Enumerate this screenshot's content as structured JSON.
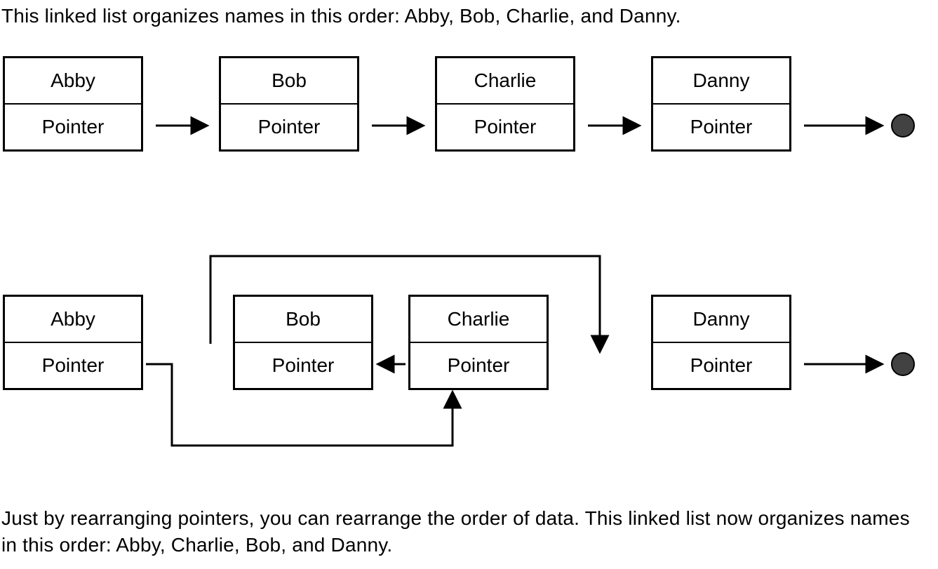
{
  "caption_top": "This linked list organizes names in this order: Abby, Bob, Charlie, and Danny.",
  "caption_bottom": "Just by rearranging pointers, you can rearrange the order of data. This linked list now organizes names in this order: Abby, Charlie, Bob, and Danny.",
  "pointer_label": "Pointer",
  "list1": {
    "nodes": [
      "Abby",
      "Bob",
      "Charlie",
      "Danny"
    ]
  },
  "list2": {
    "nodes": [
      "Abby",
      "Bob",
      "Charlie",
      "Danny"
    ]
  }
}
